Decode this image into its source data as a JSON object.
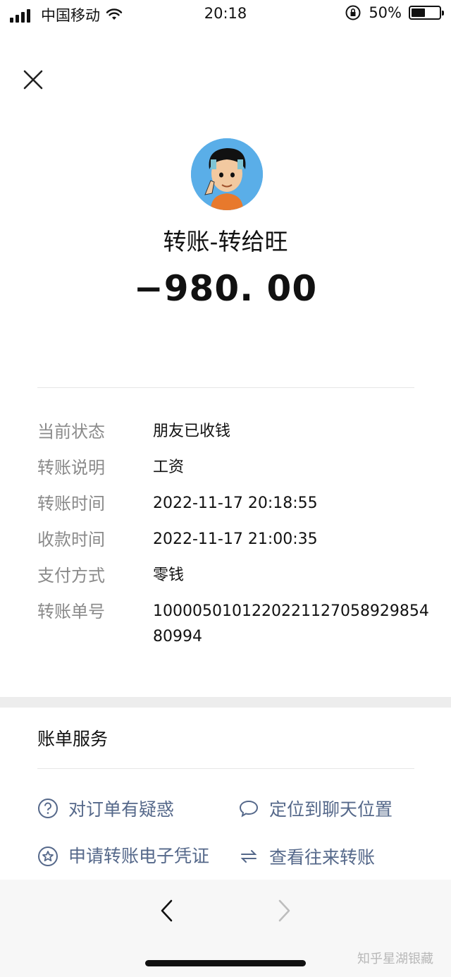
{
  "status_bar": {
    "carrier": "中国移动",
    "time": "20:18",
    "battery_percent": "50%",
    "battery_level": 0.5
  },
  "header": {
    "title": "转账-转给旺",
    "amount": "−980. 00"
  },
  "details": [
    {
      "label": "当前状态",
      "value": "朋友已收钱"
    },
    {
      "label": "转账说明",
      "value": "工资"
    },
    {
      "label": "转账时间",
      "value": "2022-11-17 20:18:55"
    },
    {
      "label": "收款时间",
      "value": "2022-11-17 21:00:35"
    },
    {
      "label": "支付方式",
      "value": "零钱"
    },
    {
      "label": "转账单号",
      "value": "100005010122022112705892985480994"
    }
  ],
  "services": {
    "title": "账单服务",
    "items": [
      {
        "label": "对订单有疑惑",
        "icon": "question-circle-icon"
      },
      {
        "label": "定位到聊天位置",
        "icon": "chat-bubble-icon"
      },
      {
        "label": "申请转账电子凭证",
        "icon": "star-circle-icon"
      },
      {
        "label": "查看往来转账",
        "icon": "swap-arrows-icon"
      }
    ]
  },
  "watermark": "知乎星湖银藏",
  "colors": {
    "link": "#55688a",
    "muted_label": "#8a8a8a",
    "avatar_bg": "#5aaee8"
  }
}
